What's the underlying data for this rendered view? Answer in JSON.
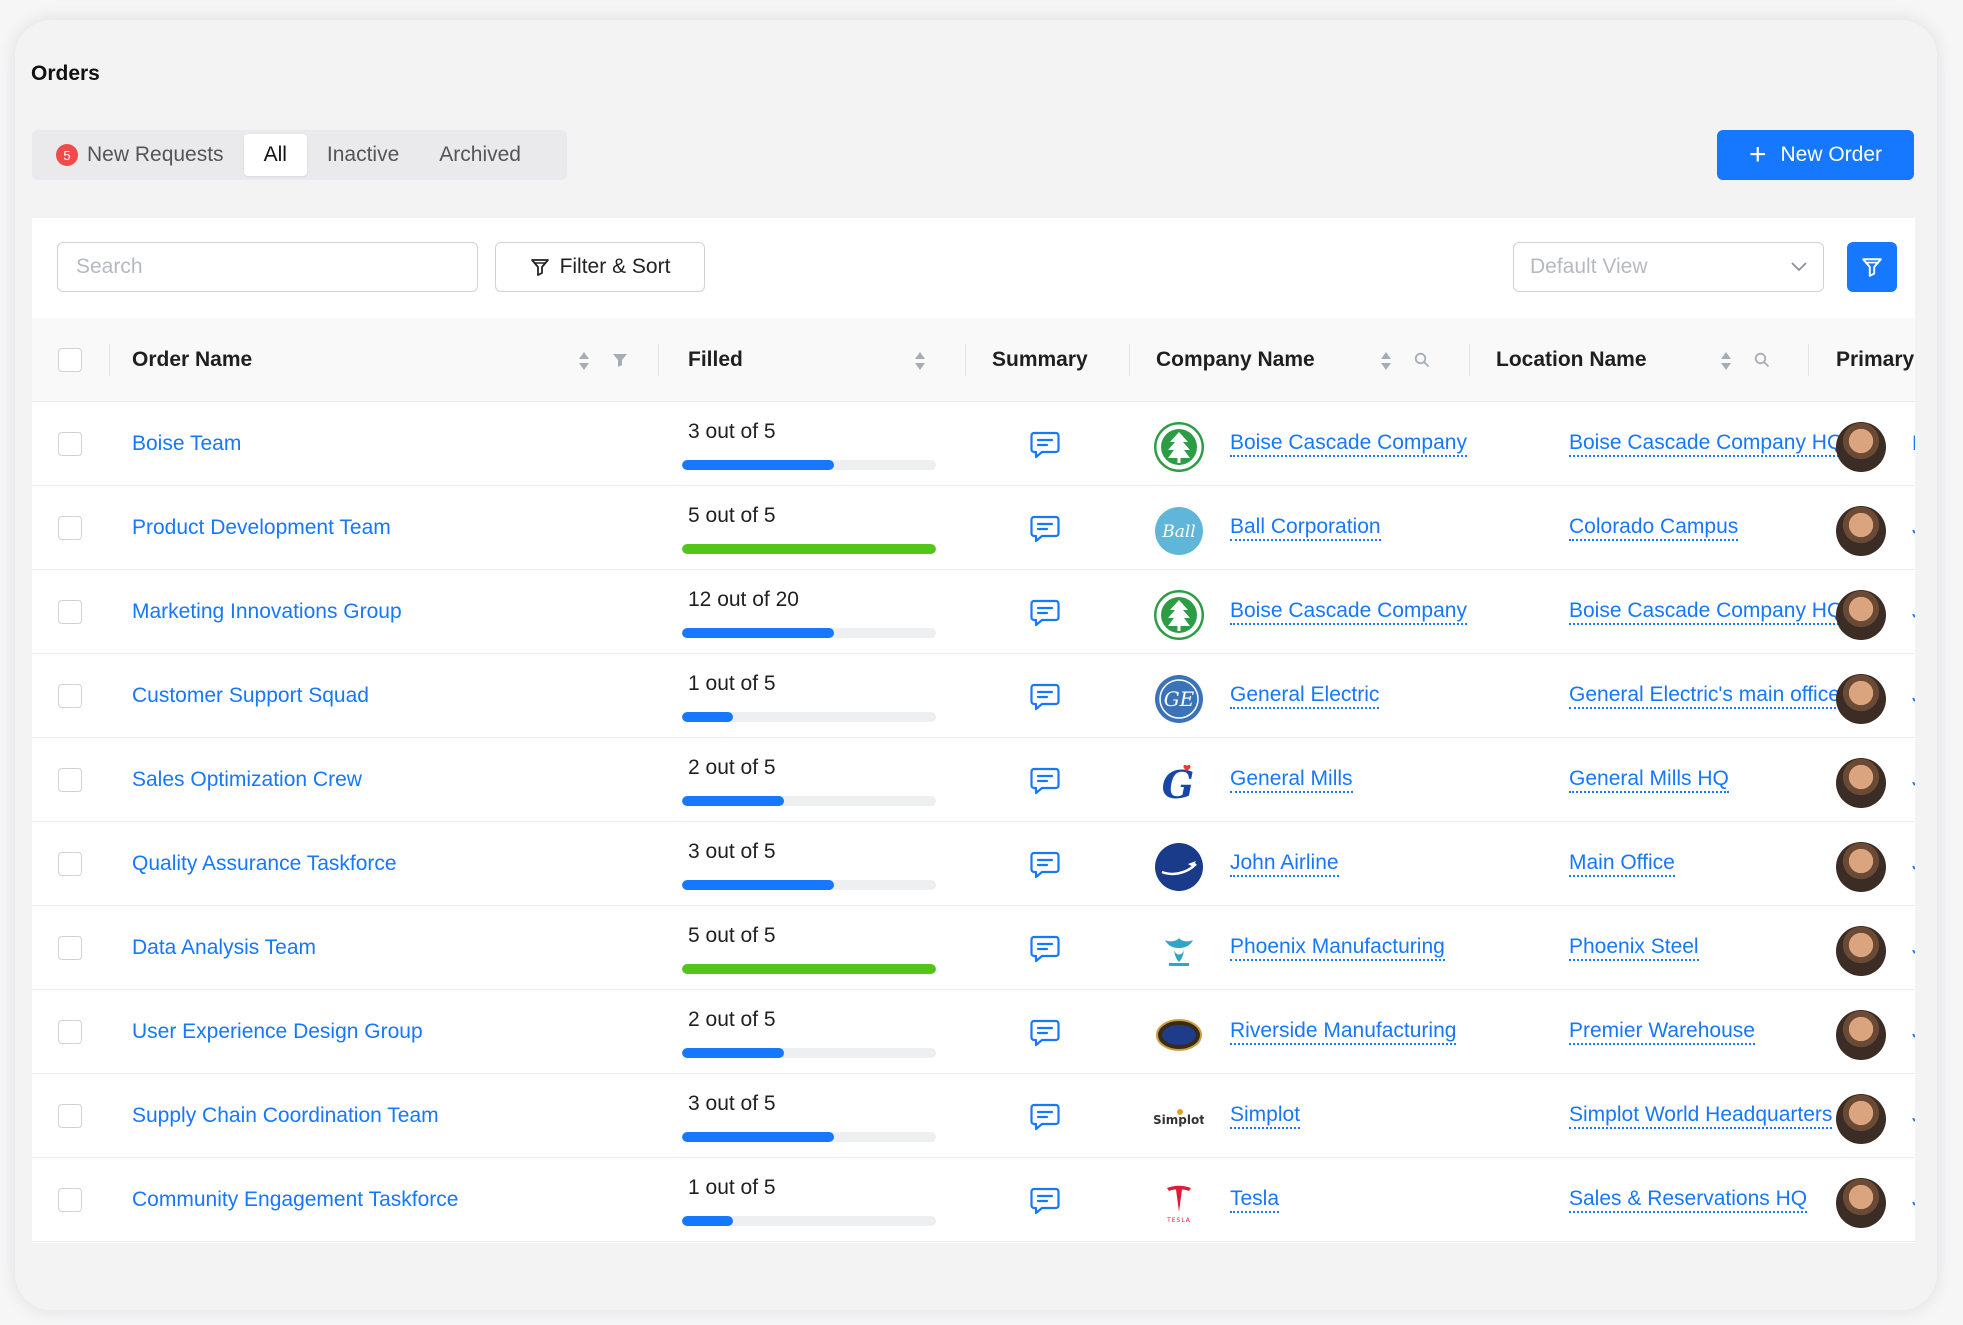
{
  "page": {
    "title": "Orders"
  },
  "tabs": {
    "new_requests": {
      "label": "New Requests",
      "badge": "5"
    },
    "all": "All",
    "inactive": "Inactive",
    "archived": "Archived"
  },
  "new_order_button": {
    "plus": "+",
    "label": "New Order"
  },
  "toolbar": {
    "search_placeholder": "Search",
    "filter_sort_label": "Filter & Sort",
    "view_placeholder": "Default View"
  },
  "columns": {
    "order_name": "Order Name",
    "filled": "Filled",
    "summary": "Summary",
    "company_name": "Company Name",
    "location_name": "Location Name",
    "primary": "Primary"
  },
  "colors": {
    "accent": "#1677ff",
    "progress_partial": "#1677ff",
    "progress_complete": "#52c41a",
    "badge": "#ef4b4b"
  },
  "rows": [
    {
      "order": "Boise Team",
      "filled_text": "3 out of 5",
      "filled": 3,
      "total": 5,
      "company": "Boise Cascade Company",
      "company_logo": "tree-logo",
      "location": "Boise Cascade Company HQ",
      "primary": "Fl"
    },
    {
      "order": "Product Development Team",
      "filled_text": "5 out of 5",
      "filled": 5,
      "total": 5,
      "company": "Ball Corporation",
      "company_logo": "ball-logo",
      "location": "Colorado Campus",
      "primary": "Jo"
    },
    {
      "order": "Marketing Innovations Group",
      "filled_text": "12 out of 20",
      "filled": 12,
      "total": 20,
      "company": "Boise Cascade Company",
      "company_logo": "tree-logo",
      "location": "Boise Cascade Company HQ",
      "primary": "Jo"
    },
    {
      "order": "Customer Support Squad",
      "filled_text": "1 out of 5",
      "filled": 1,
      "total": 5,
      "company": "General Electric",
      "company_logo": "ge-logo",
      "location": "General Electric's main office",
      "primary": "Jo"
    },
    {
      "order": "Sales Optimization Crew",
      "filled_text": "2 out of 5",
      "filled": 2,
      "total": 5,
      "company": "General Mills",
      "company_logo": "g-logo",
      "location": "General Mills HQ",
      "primary": "Jo"
    },
    {
      "order": "Quality Assurance Taskforce",
      "filled_text": "3 out of 5",
      "filled": 3,
      "total": 5,
      "company": "John Airline",
      "company_logo": "plane-logo",
      "location": "Main Office",
      "primary": "Jo"
    },
    {
      "order": "Data Analysis Team",
      "filled_text": "5 out of 5",
      "filled": 5,
      "total": 5,
      "company": "Phoenix Manufacturing",
      "company_logo": "phoenix-logo",
      "location": " Phoenix Steel",
      "primary": "Jo"
    },
    {
      "order": "User Experience Design Group",
      "filled_text": "2 out of 5",
      "filled": 2,
      "total": 5,
      "company": "Riverside Manufacturing",
      "company_logo": "seal-logo",
      "location": "Premier Warehouse",
      "primary": "Jo"
    },
    {
      "order": "Supply Chain Coordination Team",
      "filled_text": "3 out of 5",
      "filled": 3,
      "total": 5,
      "company": "Simplot",
      "company_logo": "simplot-logo",
      "location": "Simplot World Headquarters",
      "primary": "Jo"
    },
    {
      "order": "Community Engagement Taskforce",
      "filled_text": "1 out of 5",
      "filled": 1,
      "total": 5,
      "company": "Tesla",
      "company_logo": "tesla-logo",
      "location": "Sales & Reservations HQ",
      "primary": "Jo"
    }
  ]
}
